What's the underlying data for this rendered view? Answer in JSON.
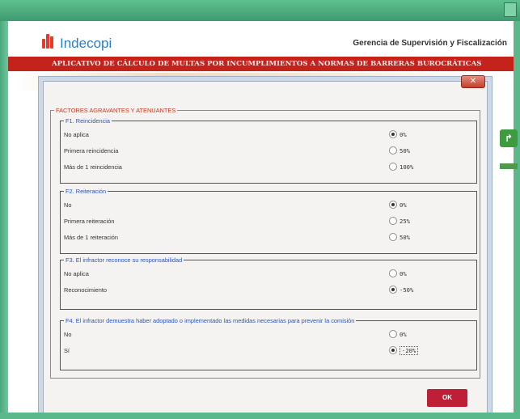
{
  "header": {
    "logo_text": "Indecopi",
    "org": "Gerencia de Supervisión y Fiscalización",
    "banner": "APLICATIVO DE CÁLCULO DE MULTAS POR INCUMPLIMIENTOS A NORMAS DE BARRERAS BUROCRÁTICAS"
  },
  "dialog": {
    "close_label": "✕",
    "section_title": "FACTORES AGRAVANTES Y ATENUANTES",
    "ok_label": "OK",
    "groups": [
      {
        "title": "F1. Reincidencia",
        "rows": [
          {
            "label": "No aplica",
            "value": "0%",
            "selected": true
          },
          {
            "label": "Primera reincidencia",
            "value": "50%",
            "selected": false
          },
          {
            "label": "Más de 1 reincidencia",
            "value": "100%",
            "selected": false
          }
        ]
      },
      {
        "title": "F2. Reiteración",
        "rows": [
          {
            "label": "No",
            "value": "0%",
            "selected": true
          },
          {
            "label": "Primera reiteración",
            "value": "25%",
            "selected": false
          },
          {
            "label": "Más de 1 reiteración",
            "value": "50%",
            "selected": false
          }
        ]
      },
      {
        "title": "F3. El infractor reconoce su responsabilidad",
        "rows": [
          {
            "label": "No aplica",
            "value": "0%",
            "selected": false
          },
          {
            "label": "Reconocimiento",
            "value": "-50%",
            "selected": true
          }
        ]
      },
      {
        "title": "F4. El infractor demuestra haber adoptado o implementado las medidas necesarias para prevenir la comisión",
        "rows": [
          {
            "label": "No",
            "value": "0%",
            "selected": false
          },
          {
            "label": "Sí",
            "value": "-20%",
            "selected": true
          }
        ]
      }
    ]
  },
  "colors": {
    "banner": "#c4231c",
    "logo": "#2b7fc2",
    "section_title": "#c0391d",
    "group_title": "#2a55b8",
    "ok_button": "#bf1e37"
  }
}
